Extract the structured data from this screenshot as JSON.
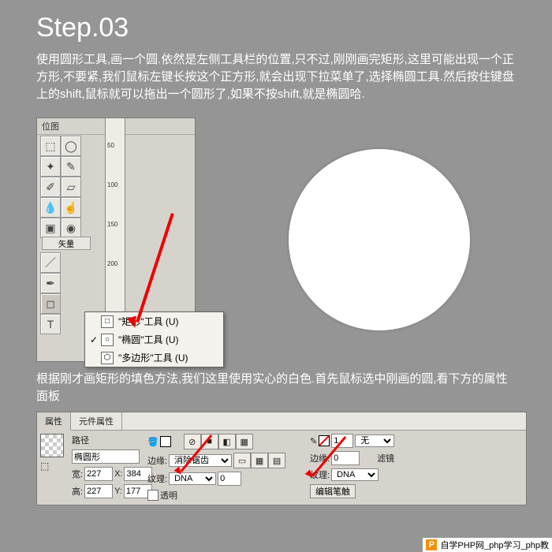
{
  "step_title": "Step.03",
  "intro": "使用圆形工具,画一个圆.依然是左侧工具栏的位置,只不过,刚刚画完矩形,这里可能出现一个正方形,不要紧,我们鼠标左键长按这个正方形,就会出现下拉菜单了,选择椭圆工具.然后按住键盘上的shift,鼠标就可以拖出一个圆形了,如果不按shift,就是椭圆哈.",
  "toolbox": {
    "title": "位图",
    "section": "矢量"
  },
  "ruler": {
    "m50": "50",
    "m100": "100",
    "m150": "150",
    "m200": "200"
  },
  "flyout": {
    "items": [
      {
        "label": "\"矩形\"工具 (U)",
        "icon": "□",
        "checked": false
      },
      {
        "label": "\"椭圆\"工具 (U)",
        "icon": "○",
        "checked": true
      },
      {
        "label": "\"多边形\"工具 (U)",
        "icon": "⬡",
        "checked": false
      }
    ]
  },
  "mid_text": "根据刚才画矩形的填色方法,我们这里使用实心的白色.首先鼠标选中刚画的圆,看下方的属性面板",
  "props": {
    "tab1": "属性",
    "tab2": "元件属性",
    "path": "路径",
    "shape": "椭圆形",
    "w_label": "宽:",
    "w": "227",
    "h_label": "高:",
    "h": "227",
    "x_label": "X:",
    "x": "384",
    "y_label": "Y:",
    "y": "177",
    "edge_label": "边缘:",
    "edge_value": "消除锯齿",
    "texture_label": "纹理:",
    "texture_value": "DNA",
    "texture_amt": "0",
    "transparent": "透明",
    "stroke_edge_label": "边缘:",
    "stroke_edge_amt": "0",
    "stroke_tex_label": "纹理:",
    "stroke_tex_value": "DNA",
    "edit_stroke": "编辑笔触",
    "none": "无",
    "filter_label": "滤镜"
  },
  "footer": {
    "text": "自学PHP网_php学习_php教"
  }
}
